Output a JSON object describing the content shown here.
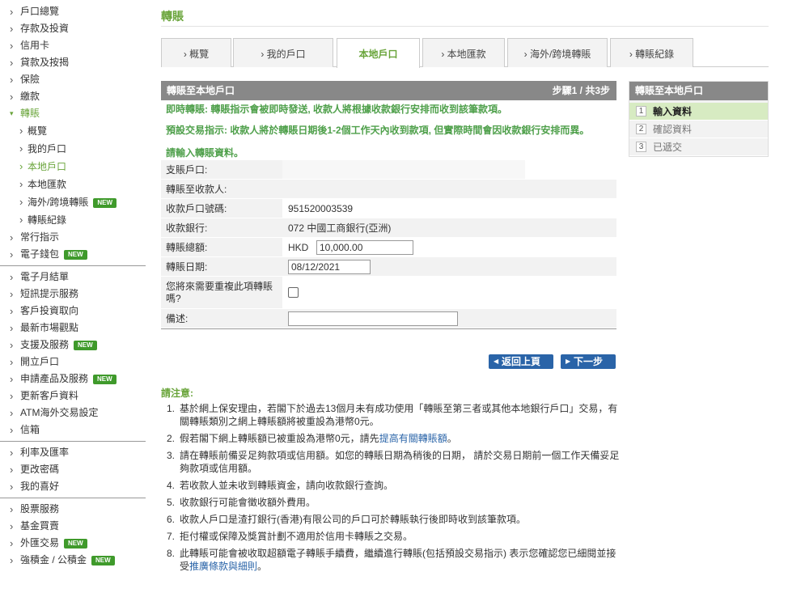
{
  "sidebar": {
    "groups": [
      [
        {
          "label": "戶口總覽"
        },
        {
          "label": "存款及投資"
        },
        {
          "label": "信用卡"
        },
        {
          "label": "貸款及按揭"
        },
        {
          "label": "保險"
        },
        {
          "label": "繳款"
        },
        {
          "label": "轉賬",
          "active": true,
          "expanded": true
        },
        {
          "label": "概覽",
          "sub": true
        },
        {
          "label": "我的戶口",
          "sub": true
        },
        {
          "label": "本地戶口",
          "sub": true,
          "active": true
        },
        {
          "label": "本地匯款",
          "sub": true
        },
        {
          "label": "海外/跨境轉賬",
          "sub": true,
          "badge": "NEW"
        },
        {
          "label": "轉賬紀錄",
          "sub": true
        },
        {
          "label": "常行指示"
        },
        {
          "label": "電子錢包",
          "badge": "NEW"
        }
      ],
      [
        {
          "label": "電子月結單"
        },
        {
          "label": "短訊提示服務"
        },
        {
          "label": "客戶投資取向"
        },
        {
          "label": "最新市場觀點"
        },
        {
          "label": "支援及服務",
          "badge": "NEW"
        },
        {
          "label": "開立戶口"
        },
        {
          "label": "申請產品及服務",
          "badge": "NEW"
        },
        {
          "label": "更新客戶資料"
        },
        {
          "label": "ATM海外交易設定"
        },
        {
          "label": "信箱"
        }
      ],
      [
        {
          "label": "利率及匯率"
        },
        {
          "label": "更改密碼"
        },
        {
          "label": "我的喜好"
        }
      ],
      [
        {
          "label": "股票服務"
        },
        {
          "label": "基金買賣"
        },
        {
          "label": "外匯交易",
          "badge": "NEW"
        },
        {
          "label": "強積金 / 公積金",
          "badge": "NEW"
        }
      ]
    ]
  },
  "page": {
    "title": "轉賬"
  },
  "tabs": [
    {
      "label": "› 概覽"
    },
    {
      "label": "› 我的戶口"
    },
    {
      "label": "本地戶口",
      "active": true
    },
    {
      "label": "› 本地匯款"
    },
    {
      "label": "› 海外/跨境轉賬"
    },
    {
      "label": "› 轉賬紀錄"
    }
  ],
  "form": {
    "header_title": "轉賬至本地戶口",
    "step_label": "步驟1 / 共3步",
    "instant_note": "即時轉賬: 轉賬指示會被即時發送, 收款人將根據收款銀行安排而收到該筆款項。",
    "scheduled_note": "預設交易指示: 收款人將於轉賬日期後1-2個工作天內收到款項, 但實際時間會因收款銀行安排而異。",
    "enter_note": "請輸入轉賬資料。",
    "rows": {
      "from_account": {
        "label": "支賬戶口:"
      },
      "to_payee": {
        "label": "轉賬至收款人:"
      },
      "account_number": {
        "label": "收款戶口號碼:",
        "value": "951520003539"
      },
      "bank": {
        "label": "收款銀行:",
        "value": "072 中國工商銀行(亞洲)"
      },
      "amount": {
        "label": "轉賬總額:",
        "currency": "HKD",
        "value": "10,000.00"
      },
      "date": {
        "label": "轉賬日期:",
        "value": "08/12/2021"
      },
      "repeat": {
        "label": "您將來需要重複此項轉賬嗎?",
        "checked": false
      },
      "memo": {
        "label": "備述:",
        "value": ""
      }
    },
    "back_button": "返回上頁",
    "next_button": "下一步"
  },
  "steps_panel": {
    "title": "轉賬至本地戶口",
    "items": [
      {
        "num": "1",
        "label": "輸入資料",
        "current": true
      },
      {
        "num": "2",
        "label": "確認資料"
      },
      {
        "num": "3",
        "label": "已遞交"
      }
    ]
  },
  "notes": {
    "title": "請注意:",
    "items": [
      {
        "num": "1.",
        "text": "基於網上保安理由，若閣下於過去13個月未有成功使用「轉賬至第三者或其他本地銀行戶口」交易，有關轉賬類別之網上轉賬額將被重設為港幣0元。"
      },
      {
        "num": "2.",
        "text": "假若閣下網上轉賬額已被重設為港幣0元，請先",
        "link": "提高有關轉賬額",
        "after": "。"
      },
      {
        "num": "3.",
        "text": "請在轉賬前備妥足夠款項或信用額。如您的轉賬日期為稍後的日期， 請於交易日期前一個工作天備妥足夠款項或信用額。"
      },
      {
        "num": "4.",
        "text": "若收款人並未收到轉賬資金，請向收款銀行查詢。"
      },
      {
        "num": "5.",
        "text": "收款銀行可能會徵收額外費用。"
      },
      {
        "num": "6.",
        "text": "收款人戶口是渣打銀行(香港)有限公司的戶口可於轉賬執行後即時收到該筆款項。"
      },
      {
        "num": "7.",
        "text": "拒付權或保障及獎賞計劃不適用於信用卡轉賬之交易。"
      },
      {
        "num": "8.",
        "text": "此轉賬可能會被收取超額電子轉賬手續費，繼續進行轉賬(包括預設交易指示) 表示您確認您已細閱並接受",
        "link": "推廣條款與細則",
        "after": "。"
      }
    ]
  },
  "colors": {
    "accent_green": "#69a43a",
    "button_blue": "#2a64a8",
    "header_gray": "#888888",
    "badge_green": "#3f9a2b"
  },
  "icons": {
    "sidebar_arrow": "chevron-right-icon",
    "expanded_arrow": "chevron-down-icon",
    "button_arrow_back": "triangle-left-icon",
    "button_arrow_next": "triangle-right-icon"
  }
}
